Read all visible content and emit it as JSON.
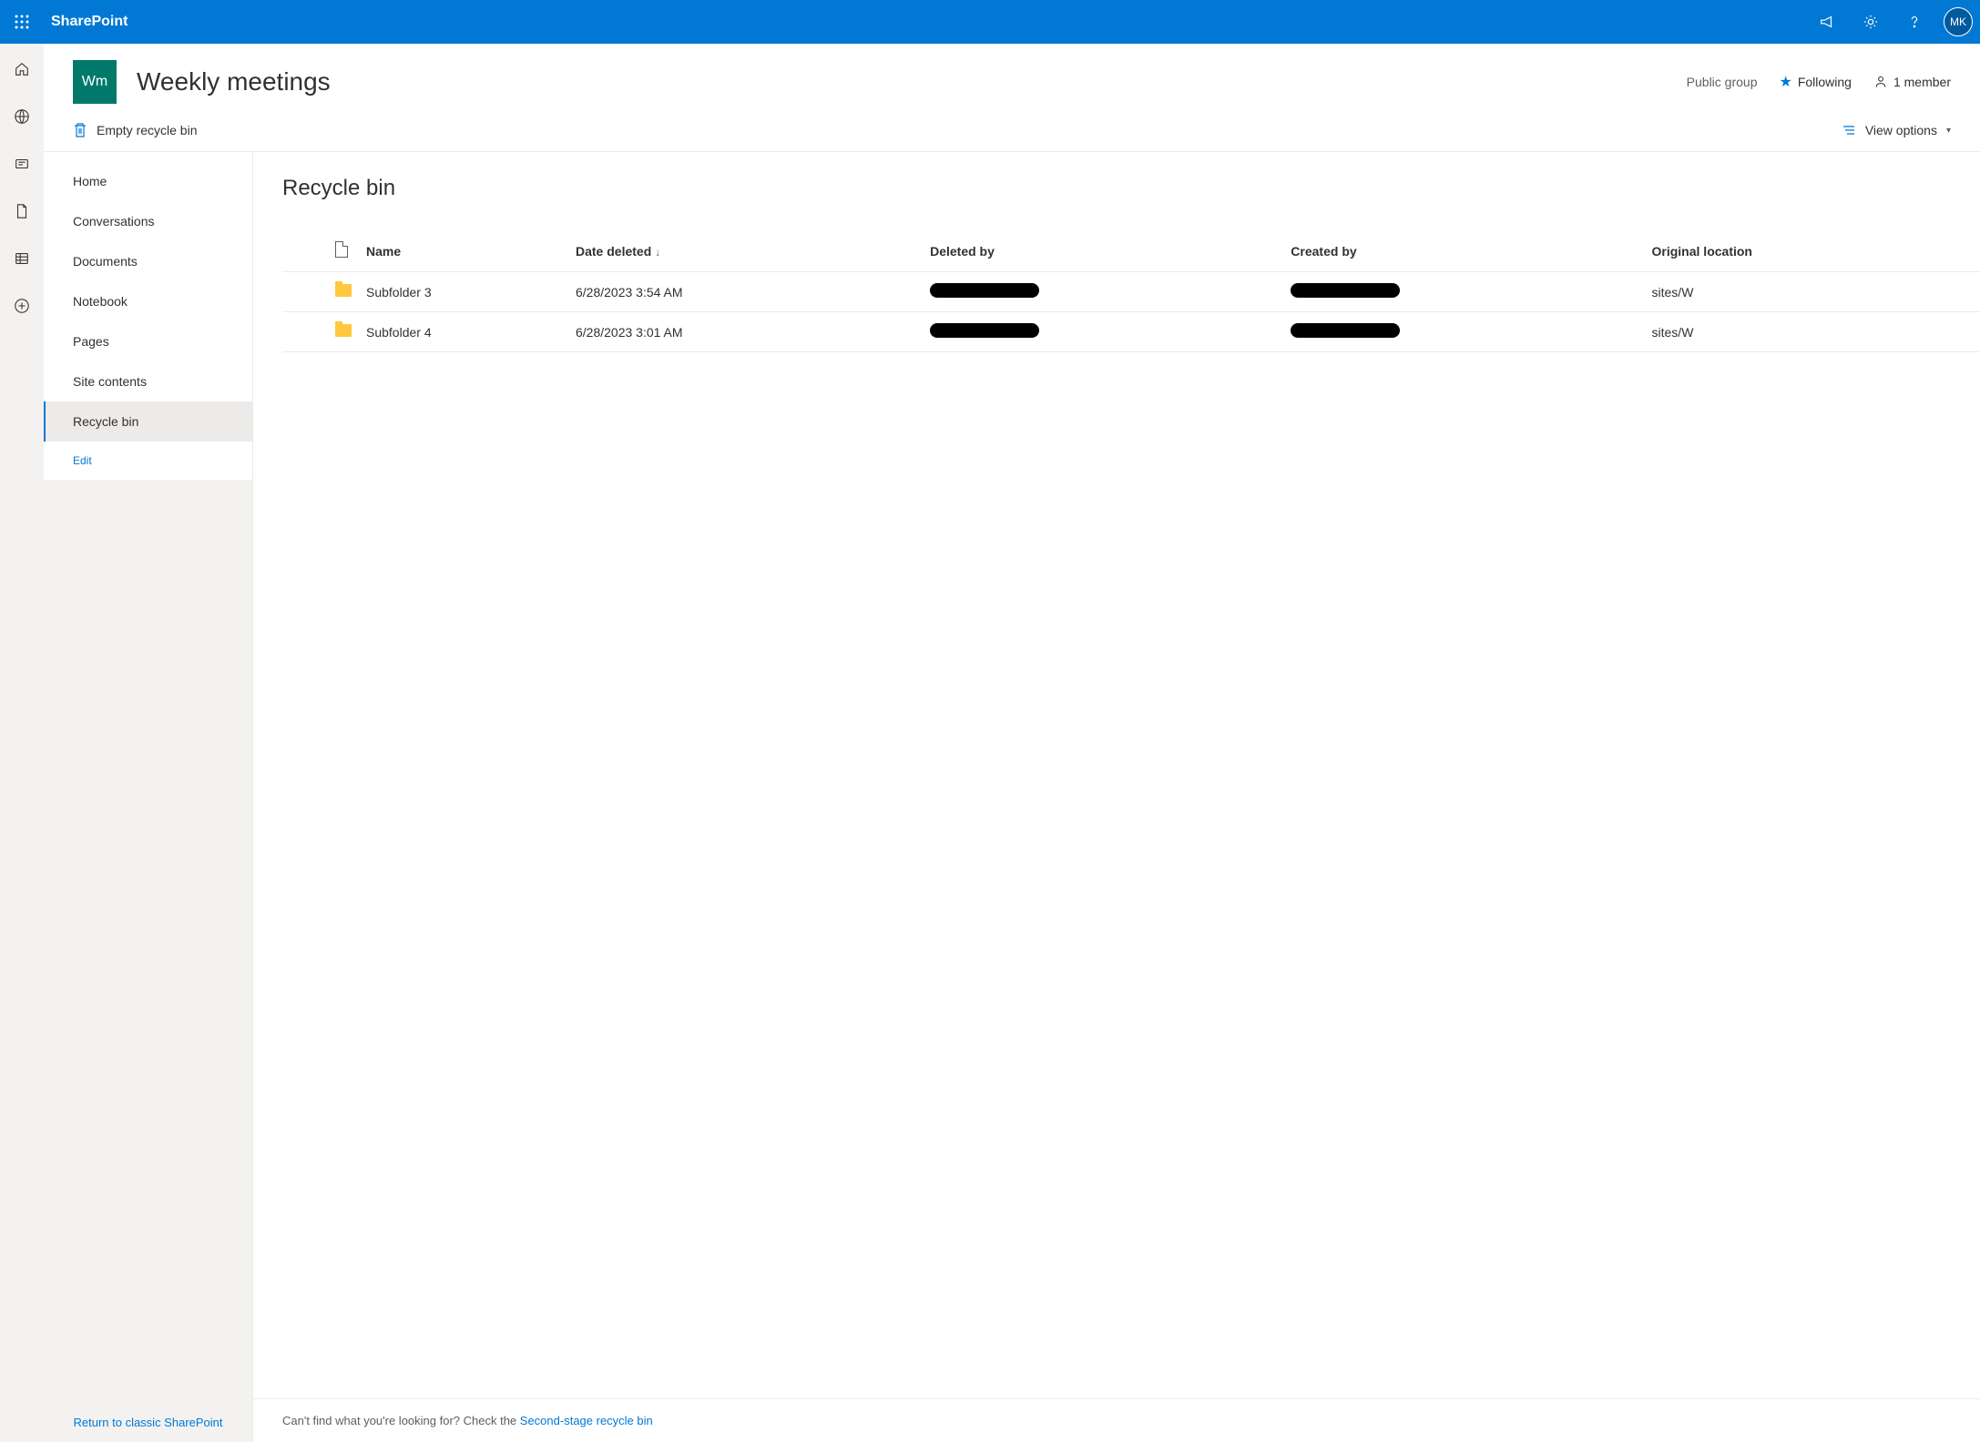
{
  "suite": {
    "brand": "SharePoint",
    "avatar_initials": "MK"
  },
  "site": {
    "logo_text": "Wm",
    "title": "Weekly meetings",
    "visibility": "Public group",
    "follow_label": "Following",
    "members_label": "1 member"
  },
  "commands": {
    "empty_label": "Empty recycle bin",
    "view_label": "View options"
  },
  "nav": {
    "items": [
      {
        "label": "Home"
      },
      {
        "label": "Conversations"
      },
      {
        "label": "Documents"
      },
      {
        "label": "Notebook"
      },
      {
        "label": "Pages"
      },
      {
        "label": "Site contents"
      },
      {
        "label": "Recycle bin",
        "active": true
      }
    ],
    "edit_label": "Edit",
    "return_label": "Return to classic SharePoint"
  },
  "page": {
    "title": "Recycle bin",
    "columns": {
      "name": "Name",
      "date_deleted": "Date deleted",
      "deleted_by": "Deleted by",
      "created_by": "Created by",
      "original": "Original location"
    },
    "rows": [
      {
        "name": "Subfolder 3",
        "date_deleted": "6/28/2023 3:54 AM",
        "original": "sites/W"
      },
      {
        "name": "Subfolder 4",
        "date_deleted": "6/28/2023 3:01 AM",
        "original": "sites/W"
      }
    ],
    "footer_text": "Can't find what you're looking for? Check the ",
    "footer_link": "Second-stage recycle bin"
  }
}
